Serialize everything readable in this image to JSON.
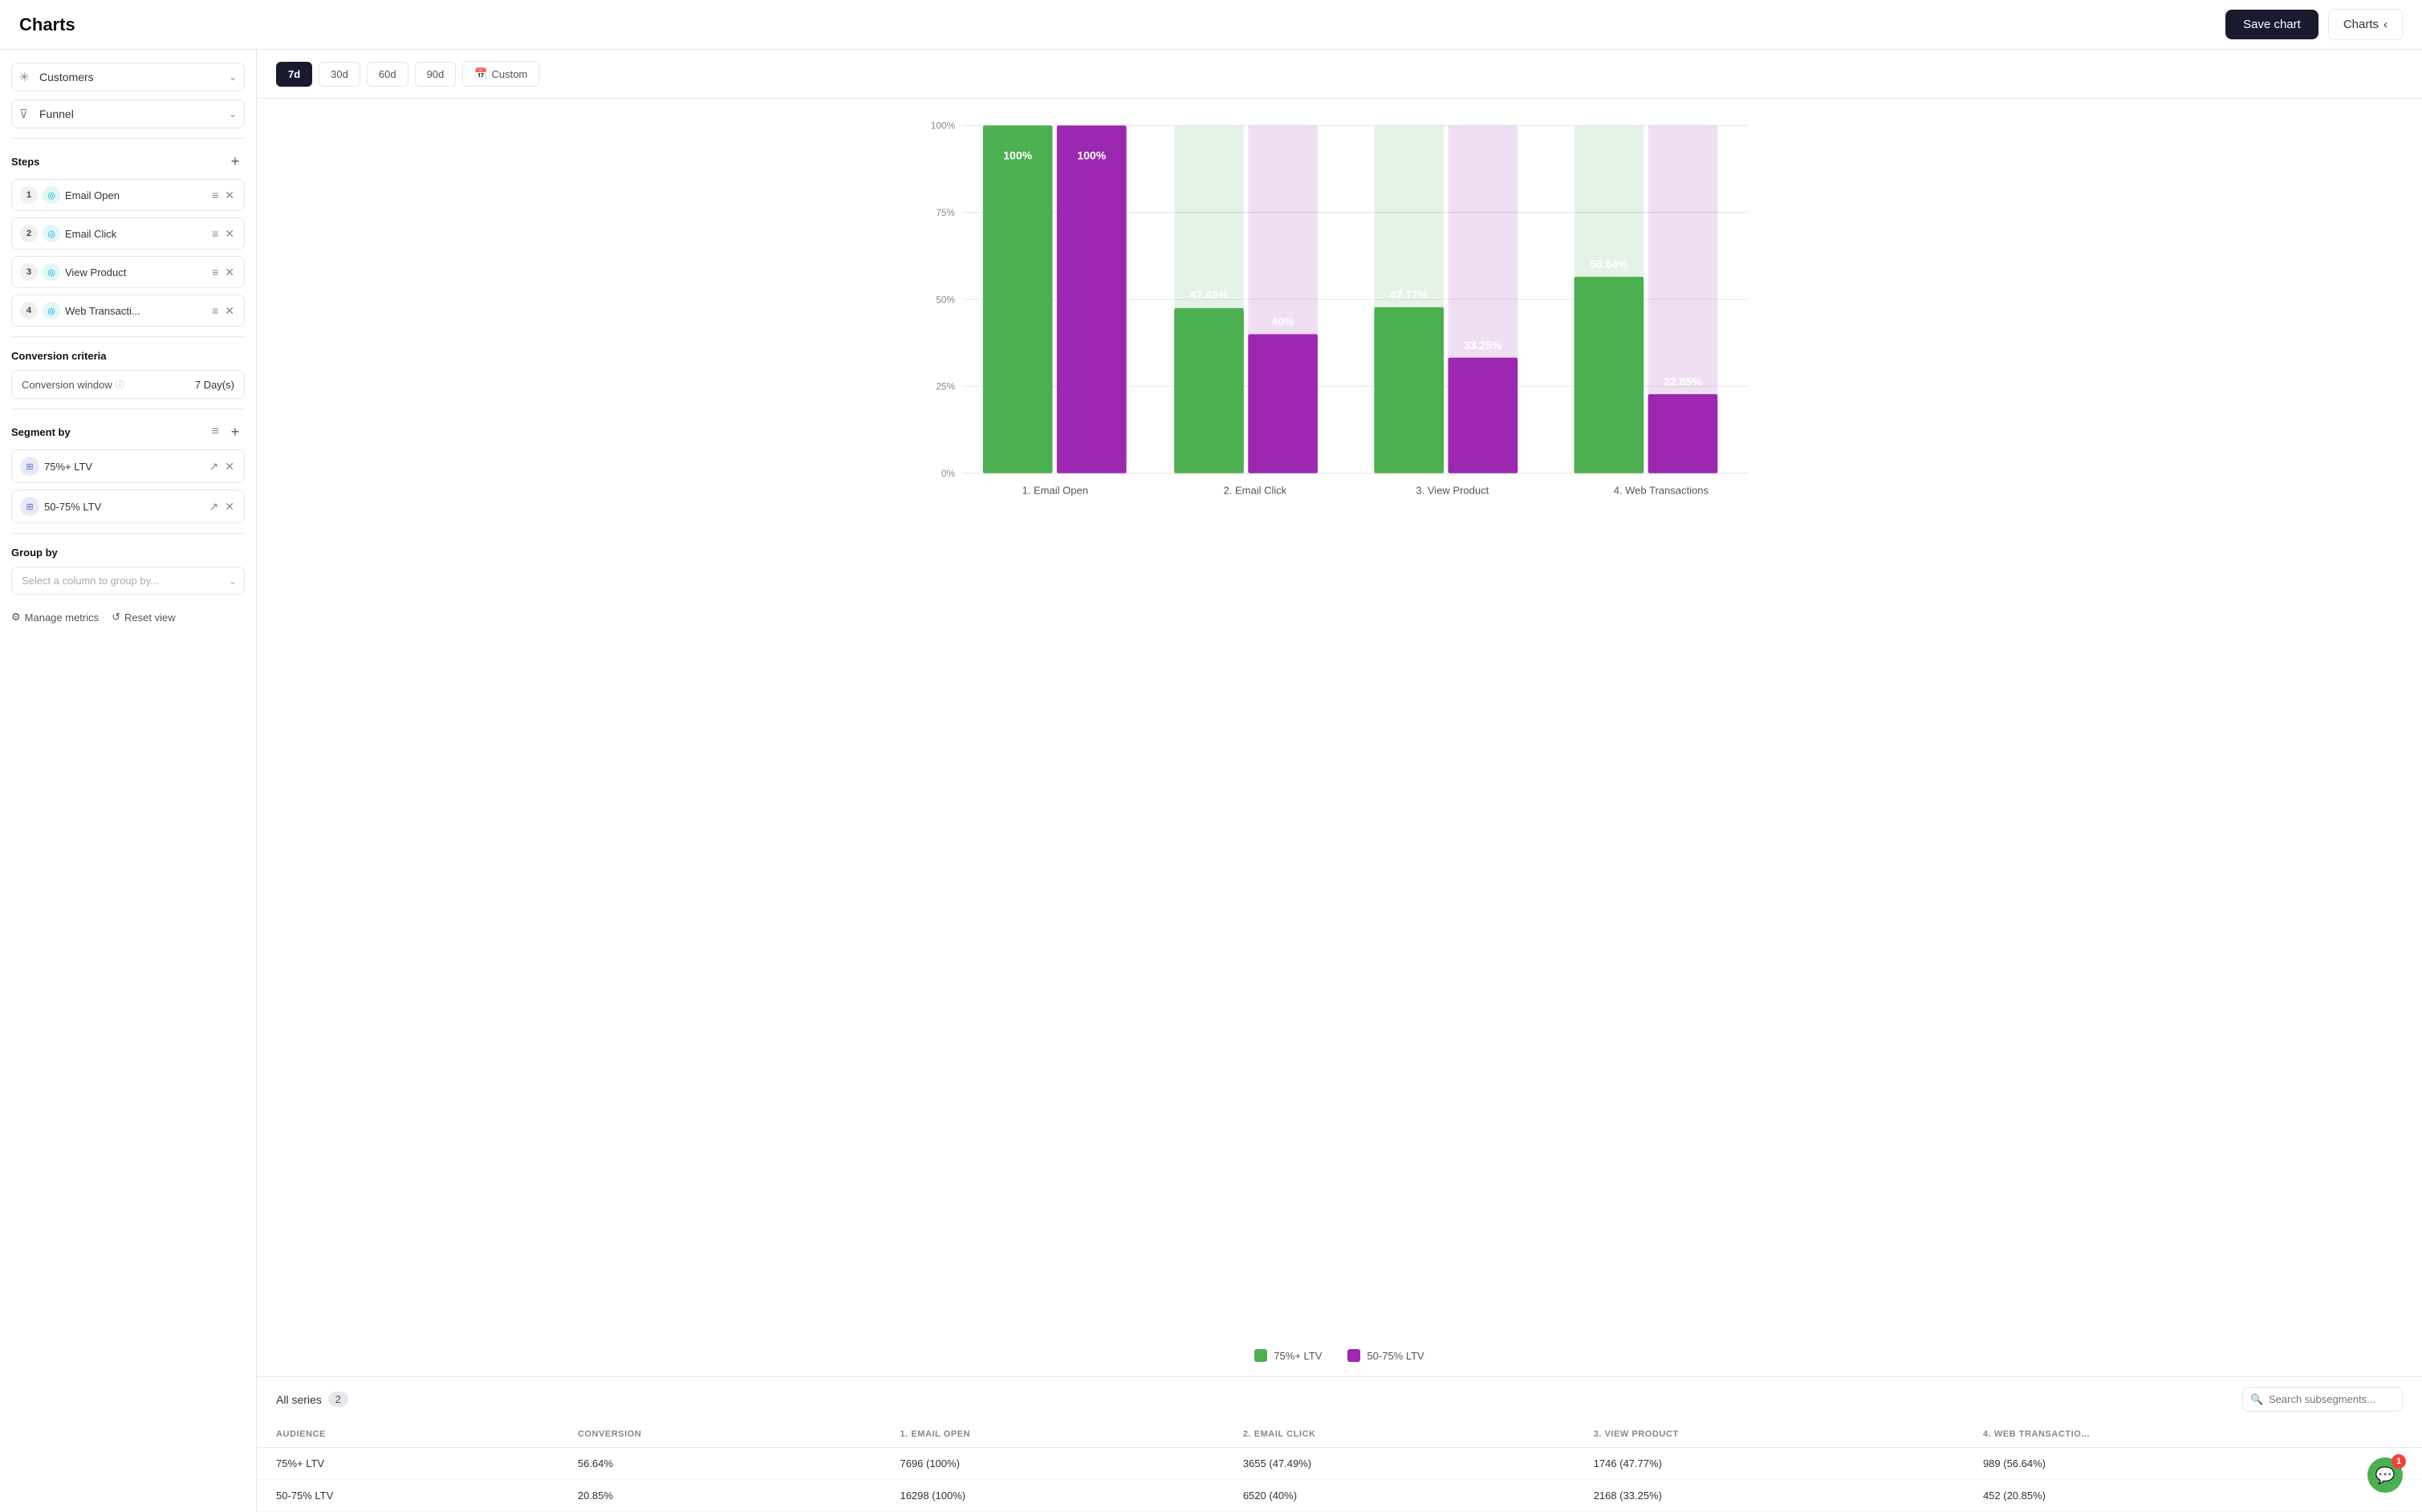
{
  "header": {
    "title": "Charts",
    "save_label": "Save chart",
    "charts_label": "Charts"
  },
  "sidebar": {
    "customers_label": "Customers",
    "funnel_label": "Funnel",
    "steps_label": "Steps",
    "steps": [
      {
        "num": 1,
        "label": "Email Open"
      },
      {
        "num": 2,
        "label": "Email Click"
      },
      {
        "num": 3,
        "label": "View Product"
      },
      {
        "num": 4,
        "label": "Web Transacti..."
      }
    ],
    "conversion_criteria_label": "Conversion criteria",
    "conversion_window_label": "Conversion window",
    "conversion_window_info": "ⓘ",
    "conversion_window_value": "7 Day(s)",
    "segment_by_label": "Segment by",
    "segments": [
      {
        "label": "75%+ LTV"
      },
      {
        "label": "50-75% LTV"
      }
    ],
    "group_by_label": "Group by",
    "group_by_placeholder": "Select a column to group by...",
    "manage_metrics_label": "Manage metrics",
    "reset_view_label": "Reset view"
  },
  "time_filters": [
    {
      "label": "7d",
      "active": true
    },
    {
      "label": "30d",
      "active": false
    },
    {
      "label": "60d",
      "active": false
    },
    {
      "label": "90d",
      "active": false
    }
  ],
  "custom_label": "Custom",
  "chart": {
    "y_labels": [
      "100%",
      "75%",
      "50%",
      "25%",
      "0%"
    ],
    "bars": [
      {
        "x_label": "1. Email Open",
        "series": [
          {
            "value": 100,
            "label": "100%",
            "color": "#4caf50",
            "opacity": 1
          },
          {
            "value": 100,
            "label": "100%",
            "color": "#9c27b0",
            "opacity": 1
          }
        ]
      },
      {
        "x_label": "2. Email Click",
        "series": [
          {
            "value": 47.49,
            "label": "47.49%",
            "color": "#4caf50",
            "opacity": 1
          },
          {
            "value": 40,
            "label": "40%",
            "color": "#9c27b0",
            "opacity": 1
          }
        ]
      },
      {
        "x_label": "3. View Product",
        "series": [
          {
            "value": 47.77,
            "label": "47.77%",
            "color": "#4caf50",
            "opacity": 1
          },
          {
            "value": 33.25,
            "label": "33.25%",
            "color": "#9c27b0",
            "opacity": 1
          }
        ]
      },
      {
        "x_label": "4. Web Transactions",
        "series": [
          {
            "value": 56.64,
            "label": "56.64%",
            "color": "#4caf50",
            "opacity": 1
          },
          {
            "value": 22.85,
            "label": "22.85%",
            "color": "#9c27b0",
            "opacity": 1
          }
        ]
      }
    ]
  },
  "legend": [
    {
      "label": "75%+ LTV",
      "color": "#4caf50"
    },
    {
      "label": "50-75% LTV",
      "color": "#9c27b0"
    }
  ],
  "table": {
    "all_series_label": "All series",
    "series_count": "2",
    "search_placeholder": "Search subsegments...",
    "columns": [
      "AUDIENCE",
      "CONVERSION",
      "1. EMAIL OPEN",
      "2. EMAIL CLICK",
      "3. VIEW PRODUCT",
      "4. WEB TRANSACTIO..."
    ],
    "rows": [
      {
        "audience": "75%+ LTV",
        "conversion": "56.64%",
        "col1": "7696 (100%)",
        "col2": "3655 (47.49%)",
        "col3": "1746 (47.77%)",
        "col4": "989 (56.64%)"
      },
      {
        "audience": "50-75% LTV",
        "conversion": "20.85%",
        "col1": "16298 (100%)",
        "col2": "6520 (40%)",
        "col3": "2168 (33.25%)",
        "col4": "452 (20.85%)"
      }
    ]
  },
  "notification": {
    "count": "1",
    "icon": "💬"
  }
}
